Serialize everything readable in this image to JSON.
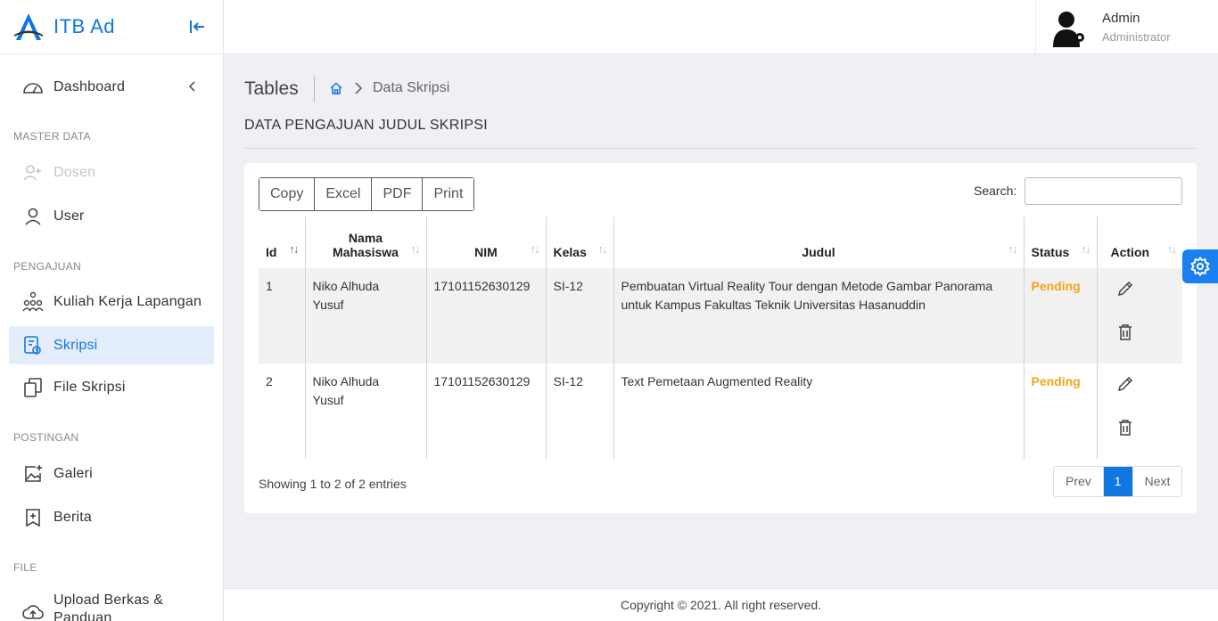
{
  "brand": {
    "name": "ITB Ad"
  },
  "sidebar": {
    "dashboard": "Dashboard",
    "sections": {
      "master": "MASTER DATA",
      "pengajuan": "PENGAJUAN",
      "postingan": "POSTINGAN",
      "file": "FILE"
    },
    "items": {
      "dosen": "Dosen",
      "user": "User",
      "kkl": "Kuliah Kerja Lapangan",
      "skripsi": "Skripsi",
      "file_skripsi": "File Skripsi",
      "galeri": "Galeri",
      "berita": "Berita",
      "upload": "Upload Berkas &",
      "upload2": "Panduan"
    }
  },
  "user": {
    "name": "Admin",
    "role": "Administrator"
  },
  "page": {
    "title": "Tables",
    "breadcrumb": "Data Skripsi",
    "section_title": "DATA PENGAJUAN JUDUL SKRIPSI"
  },
  "toolbar": {
    "copy": "Copy",
    "excel": "Excel",
    "pdf": "PDF",
    "print": "Print",
    "search_label": "Search:"
  },
  "table": {
    "headers": {
      "id": "Id",
      "nama1": "Nama",
      "nama2": "Mahasiswa",
      "nim": "NIM",
      "kelas": "Kelas",
      "judul": "Judul",
      "status": "Status",
      "action": "Action"
    },
    "rows": [
      {
        "id": "1",
        "nama1": "Niko Alhuda",
        "nama2": "Yusuf",
        "nim": "17101152630129",
        "kelas": "SI-12",
        "judul": "Pembuatan Virtual Reality Tour dengan Metode Gambar Panorama untuk Kampus Fakultas Teknik Universitas Hasanuddin",
        "status": "Pending"
      },
      {
        "id": "2",
        "nama1": "Niko Alhuda",
        "nama2": "Yusuf",
        "nim": "17101152630129",
        "kelas": "SI-12",
        "judul": "Text Pemetaan Augmented Reality",
        "status": "Pending"
      }
    ]
  },
  "pagination": {
    "info": "Showing 1 to 2 of 2 entries",
    "prev": "Prev",
    "current": "1",
    "next": "Next"
  },
  "footer": {
    "text": "Copyright © 2021. All right reserved."
  },
  "colors": {
    "accent": "#1177e0",
    "pending": "#f5a31a",
    "active_bg": "#e3edfb"
  }
}
